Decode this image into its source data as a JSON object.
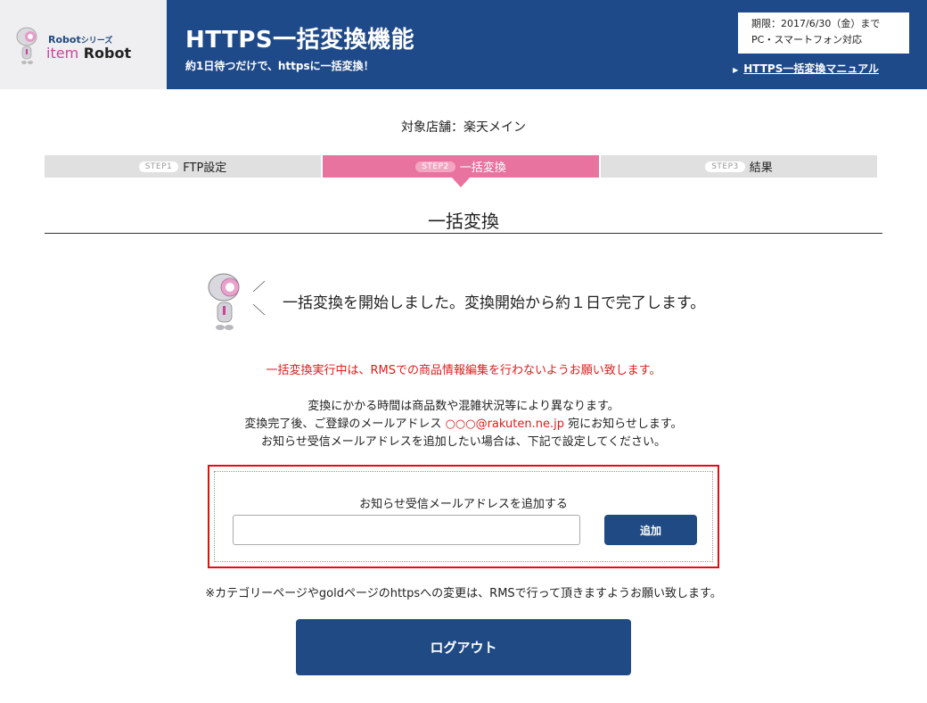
{
  "logo": {
    "series": "Robot",
    "series_suffix": "シリーズ",
    "item": "item",
    "robot": "Robot"
  },
  "header": {
    "title": "HTTPS一括変換機能",
    "subtitle": "約1日待つだけで、httpsに一括変換！",
    "deadline_line1": "期限：2017/6/30（金）まで",
    "deadline_line2": "PC・スマートフォン対応",
    "manual_link": "HTTPS一括変換マニュアル"
  },
  "store": "対象店舗：楽天メイン",
  "steps": [
    {
      "badge": "STEP1",
      "label": "FTP設定",
      "active": false
    },
    {
      "badge": "STEP2",
      "label": "一括変換",
      "active": true
    },
    {
      "badge": "STEP3",
      "label": "結果",
      "active": false
    }
  ],
  "section_title": "一括変換",
  "message": "一括変換を開始しました。変換開始から約１日で完了します。",
  "warning": "一括変換実行中は、RMSでの商品情報編集を行わないようお願い致します。",
  "info": {
    "line1": "変換にかかる時間は商品数や混雑状況等により異なります。",
    "line2_prefix": "変換完了後、ご登録のメールアドレス ",
    "email": "○○○@rakuten.ne.jp",
    "line2_suffix": " 宛にお知らせします。",
    "line3": "お知らせ受信メールアドレスを追加したい場合は、下記で設定してください。"
  },
  "form": {
    "label": "お知らせ受信メールアドレスを追加する",
    "input_value": "",
    "input_placeholder": "",
    "add_button": "追加"
  },
  "note": "※カテゴリーページやgoldページのhttpsへの変更は、RMSで行って頂きますようお願い致します。",
  "logout_button": "ログアウト",
  "colors": {
    "header_blue": "#1f4a8a",
    "step_active_pink": "#e9739f",
    "warning_red": "#e01b1b",
    "button_blue": "#1f4a84"
  }
}
